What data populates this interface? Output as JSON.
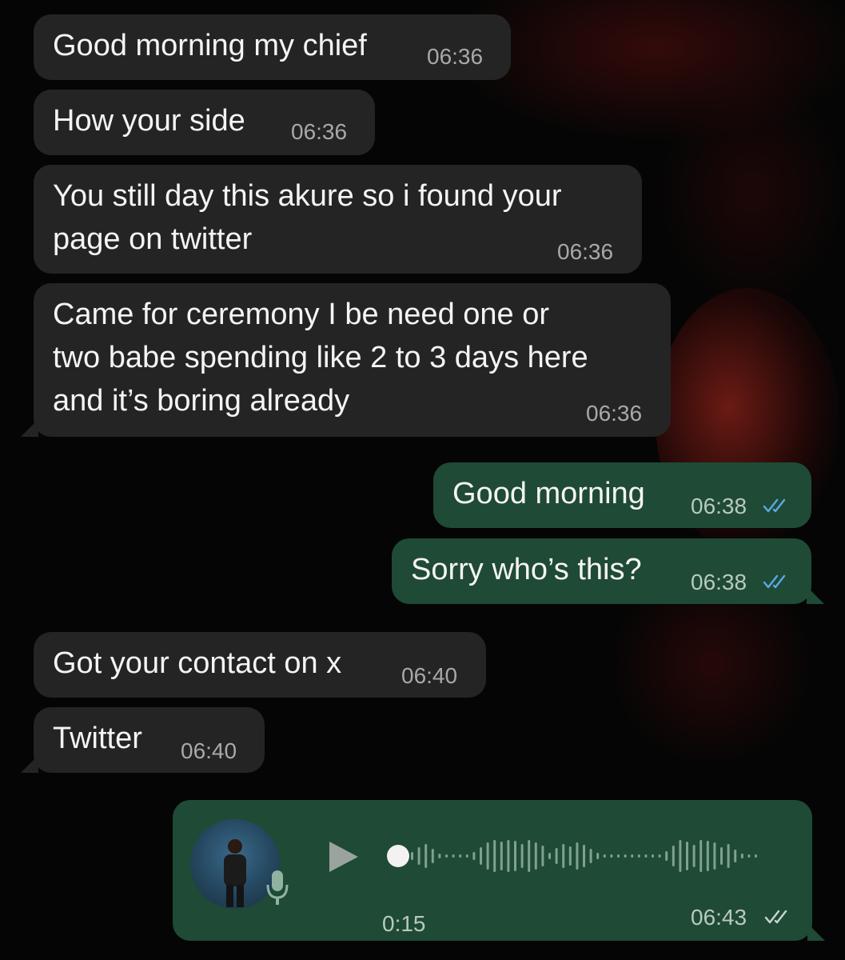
{
  "colors": {
    "incoming_bubble": "#242424",
    "outgoing_bubble": "#1f4a35",
    "read_ticks": "#5aa9e6",
    "background": "#050505"
  },
  "messages": [
    {
      "direction": "incoming",
      "text": "Good morning my chief",
      "time": "06:36"
    },
    {
      "direction": "incoming",
      "text": "How your side",
      "time": "06:36"
    },
    {
      "direction": "incoming",
      "line1": "You still day this akure so i found your",
      "line2": "page on twitter",
      "time": "06:36"
    },
    {
      "direction": "incoming",
      "line1": "Came for ceremony I be need one or",
      "line2": "two babe spending like 2 to 3 days here",
      "line3": "and it’s boring already",
      "time": "06:36"
    },
    {
      "direction": "outgoing",
      "text": "Good morning",
      "time": "06:38",
      "status": "read"
    },
    {
      "direction": "outgoing",
      "text": "Sorry who’s this?",
      "time": "06:38",
      "status": "read"
    },
    {
      "direction": "incoming",
      "text": "Got your contact on x",
      "time": "06:40"
    },
    {
      "direction": "incoming",
      "text": "Twitter",
      "time": "06:40"
    }
  ],
  "voice_note": {
    "direction": "outgoing",
    "duration": "0:15",
    "time": "06:43",
    "status": "delivered",
    "progress": 0
  }
}
